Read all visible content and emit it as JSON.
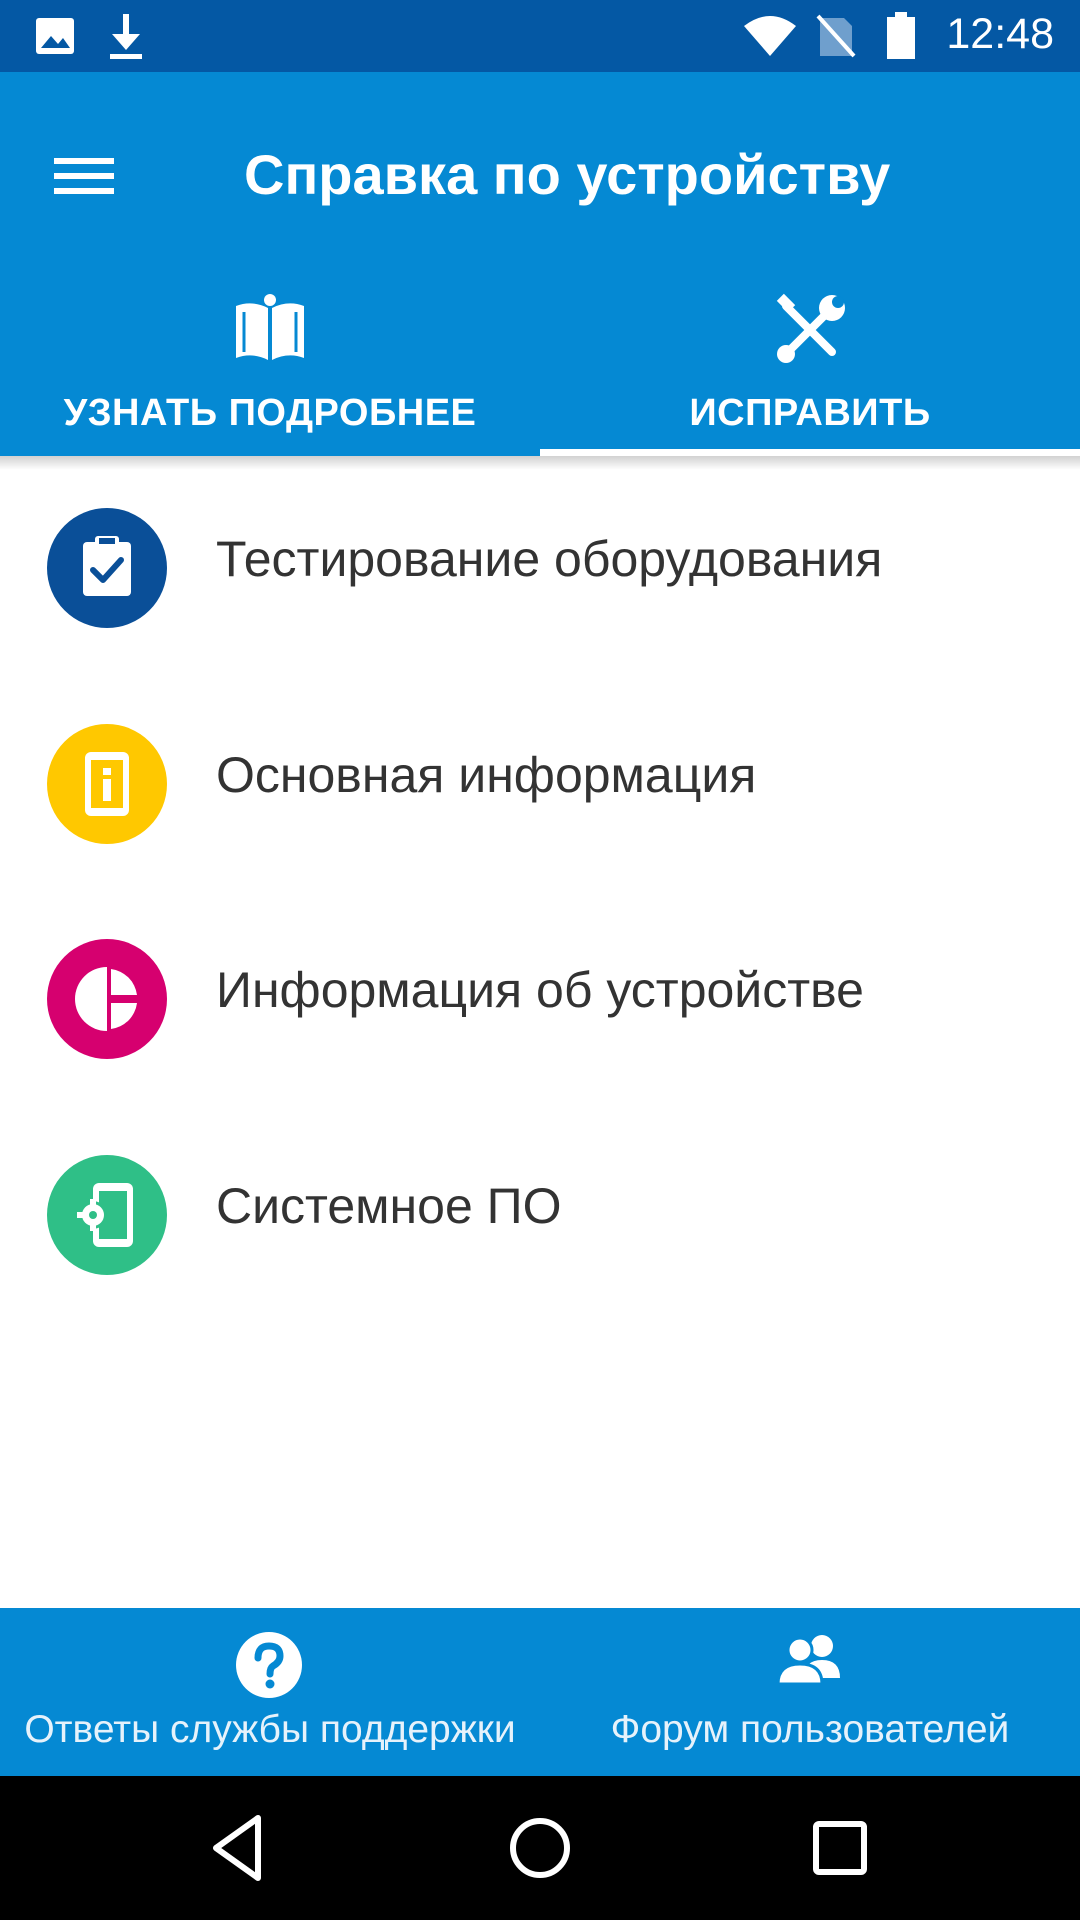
{
  "status_bar": {
    "time": "12:48",
    "icons": [
      "image-icon",
      "download-icon",
      "wifi-icon",
      "no-sim-icon",
      "battery-icon"
    ]
  },
  "app_bar": {
    "title": "Справка по устройству",
    "menu_icon": "hamburger-menu-icon"
  },
  "tabs": [
    {
      "label": "УЗНАТЬ ПОДРОБНЕЕ",
      "icon": "open-book-icon",
      "selected": false
    },
    {
      "label": "ИСПРАВИТЬ",
      "icon": "tools-icon",
      "selected": true
    }
  ],
  "list": {
    "items": [
      {
        "label": "Тестирование оборудования",
        "icon": "clipboard-check-icon",
        "color": "#0a4f98"
      },
      {
        "label": "Основная информация",
        "icon": "phone-info-icon",
        "color": "#ffc800"
      },
      {
        "label": "Информация об устройстве",
        "icon": "pie-chart-icon",
        "color": "#d6006f"
      },
      {
        "label": "Системное ПО",
        "icon": "phone-settings-icon",
        "color": "#2fbf87"
      }
    ]
  },
  "bottom_bar": {
    "support_label": "Ответы службы поддержки",
    "support_icon": "help-circle-icon",
    "forum_label": "Форум пользователей",
    "forum_icon": "users-icon"
  },
  "nav_bar": {
    "buttons": [
      "back-icon",
      "home-icon",
      "recents-icon"
    ]
  },
  "colors": {
    "status_bar": "#0458a4",
    "app_bar": "#0589d3",
    "text": "#333333"
  }
}
